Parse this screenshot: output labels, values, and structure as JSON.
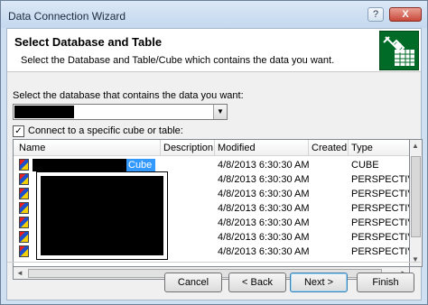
{
  "window": {
    "title": "Data Connection Wizard",
    "help_btn": "?",
    "close_btn": "X"
  },
  "header": {
    "title": "Select Database and Table",
    "subtitle": "Select the Database and Table/Cube which contains the data you want."
  },
  "database": {
    "label": "Select the database that contains the data you want:",
    "selected_value": ""
  },
  "connect_checkbox": {
    "label": "Connect to a specific cube or table:",
    "checked": true
  },
  "list": {
    "columns": [
      "Name",
      "Description",
      "Modified",
      "Created",
      "Type"
    ],
    "rows": [
      {
        "name": "Cube",
        "modified": "4/8/2013 6:30:30 AM",
        "type": "CUBE",
        "selected": true
      },
      {
        "name": "",
        "modified": "4/8/2013 6:30:30 AM",
        "type": "PERSPECTIVE"
      },
      {
        "name": "",
        "modified": "4/8/2013 6:30:30 AM",
        "type": "PERSPECTIVE"
      },
      {
        "name": "",
        "modified": "4/8/2013 6:30:30 AM",
        "type": "PERSPECTIVE"
      },
      {
        "name": "",
        "modified": "4/8/2013 6:30:30 AM",
        "type": "PERSPECTIVE"
      },
      {
        "name": "",
        "modified": "4/8/2013 6:30:30 AM",
        "type": "PERSPECTIVE"
      },
      {
        "name": "",
        "modified": "4/8/2013 6:30:30 AM",
        "type": "PERSPECTIVE"
      }
    ]
  },
  "buttons": {
    "cancel": "Cancel",
    "back": "< Back",
    "next": "Next >",
    "finish": "Finish"
  },
  "icons": {
    "wizard": "data-connection-plug-icon",
    "row": "cube-icon",
    "scroll_up": "▲",
    "scroll_down": "▼",
    "scroll_left": "◄",
    "scroll_right": "►"
  },
  "colors": {
    "selection": "#3399ff",
    "wizard_icon_bg": "#006b27"
  }
}
